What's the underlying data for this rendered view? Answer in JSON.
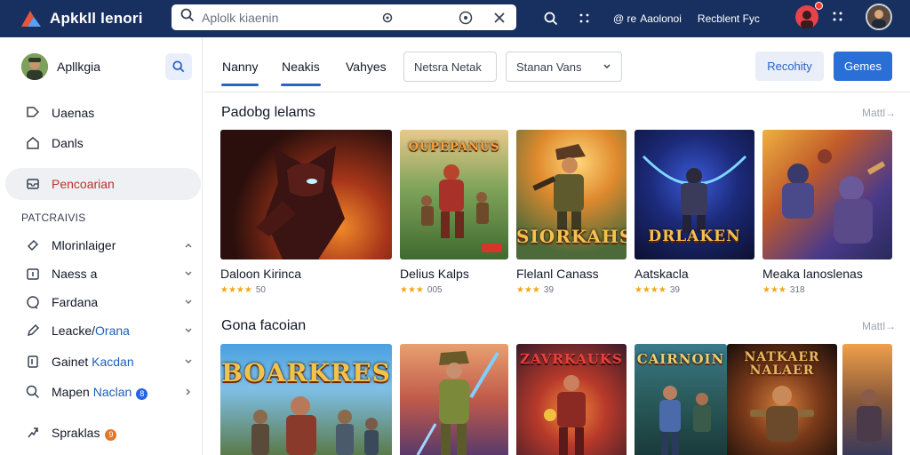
{
  "topbar": {
    "app_title": "Apkkll lenori",
    "search_text": "Aplolk kiaenin",
    "link1": "Aaolonoi",
    "link1_prefix": "@ re",
    "link2": "Recblent Fyc"
  },
  "sidebar": {
    "profile_name": "Apllkgia",
    "nav": [
      {
        "label": "Uaenas",
        "icon": "tag-icon"
      },
      {
        "label": "Danls",
        "icon": "home-icon"
      }
    ],
    "active": {
      "label": "Pencoarian",
      "icon": "inbox-icon"
    },
    "section_title": "PATCRAIVIS",
    "categories": [
      {
        "label": "Mlorinlaiger",
        "icon": "ticket-icon",
        "chevron": "up"
      },
      {
        "label": "Naess a",
        "icon": "calendar-icon",
        "chevron": "down"
      },
      {
        "label": "Fardana",
        "icon": "chat-icon",
        "chevron": "down"
      },
      {
        "label": "Leacke",
        "label_extra": "Orana",
        "icon": "pen-icon",
        "chevron": "down"
      },
      {
        "label": "Gainet",
        "label_extra": "Kacdan",
        "icon": "book-icon",
        "chevron": "down"
      },
      {
        "label": "Mapen",
        "label_extra": "Naclan",
        "icon": "search-icon",
        "chevron": "right",
        "badge": "8"
      },
      {
        "label": "Spraklas",
        "icon": "share-icon",
        "badge": "9"
      }
    ]
  },
  "main": {
    "tabs": [
      "Nanny",
      "Neakis",
      "Vahyes"
    ],
    "filter1": "Netsra Netak",
    "filter2": "Stanan Vans",
    "btn_secondary": "Recohity",
    "btn_primary": "Gemes",
    "section1": {
      "title": "Padobg lelams",
      "more": "Mattl→",
      "cards": [
        {
          "title": "Daloon Kirinca",
          "stars": "★★★★",
          "score": "50"
        },
        {
          "title": "Delius Kalps",
          "stars": "★★★",
          "score": "005",
          "art": "OUPEPANUS"
        },
        {
          "title": "Flelanl Canass",
          "stars": "★★★",
          "score": "39",
          "art": "SIORKAHS"
        },
        {
          "title": "Aatskacla",
          "stars": "★★★★",
          "score": "39",
          "art": "DRLAKEN"
        },
        {
          "title": "Meaka lanoslenas",
          "stars": "★★★",
          "score": "318"
        }
      ]
    },
    "section2": {
      "title": "Gona facoian",
      "more": "Mattl→",
      "cards": [
        {
          "art": "BOARKRES"
        },
        {
          "art": ""
        },
        {
          "art": "ZAVRKAUKS"
        },
        {
          "art": "CAIRNOIN"
        },
        {
          "art": "NATKAER NALAER"
        },
        {
          "art": ""
        }
      ]
    }
  },
  "colors": {
    "topbar": "#17305f",
    "accent": "#2a62c9",
    "active_text": "#b8322b",
    "star": "#f2a71b"
  }
}
